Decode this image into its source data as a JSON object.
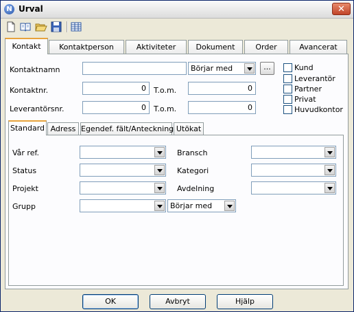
{
  "window": {
    "title": "Urval",
    "close_label": "✕"
  },
  "toolbar": {
    "buttons": [
      {
        "name": "new-icon",
        "label": ""
      },
      {
        "name": "open-book-icon",
        "label": ""
      },
      {
        "name": "open-folder-icon",
        "label": ""
      },
      {
        "name": "save-icon",
        "label": ""
      },
      {
        "name": "table-icon",
        "label": ""
      }
    ]
  },
  "top_tabs": [
    "Kontakt",
    "Kontaktperson",
    "Aktiviteter",
    "Dokument",
    "Order",
    "Avancerat"
  ],
  "top_tabs_active": "Kontakt",
  "kontakt": {
    "kontaktnamn_label": "Kontaktnamn",
    "kontaktnamn_value": "",
    "match_combo_value": "Börjar med",
    "dots_label": "...",
    "kontaktnr_label": "Kontaktnr.",
    "kontaktnr_from": "0",
    "kontaktnr_tom_label": "T.o.m.",
    "kontaktnr_to": "0",
    "leverantorsnr_label": "Leverantörsnr.",
    "leverantorsnr_from": "0",
    "leverantorsnr_tom_label": "T.o.m.",
    "leverantorsnr_to": "0",
    "checkboxes": [
      {
        "label": "Kund",
        "checked": false
      },
      {
        "label": "Leverantör",
        "checked": false
      },
      {
        "label": "Partner",
        "checked": false
      },
      {
        "label": "Privat",
        "checked": false
      },
      {
        "label": "Huvudkontor",
        "checked": false
      }
    ]
  },
  "inner_tabs": [
    "Standard",
    "Adress",
    "Egendef. fält/Anteckning",
    "Utökat"
  ],
  "inner_tabs_active": "Standard",
  "standard": {
    "var_ref_label": "Vår ref.",
    "var_ref_value": "",
    "status_label": "Status",
    "status_value": "",
    "projekt_label": "Projekt",
    "projekt_value": "",
    "grupp_label": "Grupp",
    "grupp_value": "",
    "grupp_match_value": "Börjar med",
    "bransch_label": "Bransch",
    "bransch_value": "",
    "kategori_label": "Kategori",
    "kategori_value": "",
    "avdelning_label": "Avdelning",
    "avdelning_value": ""
  },
  "buttons": {
    "ok_label": "OK",
    "cancel_label": "Avbryt",
    "help_label": "Hjälp"
  }
}
